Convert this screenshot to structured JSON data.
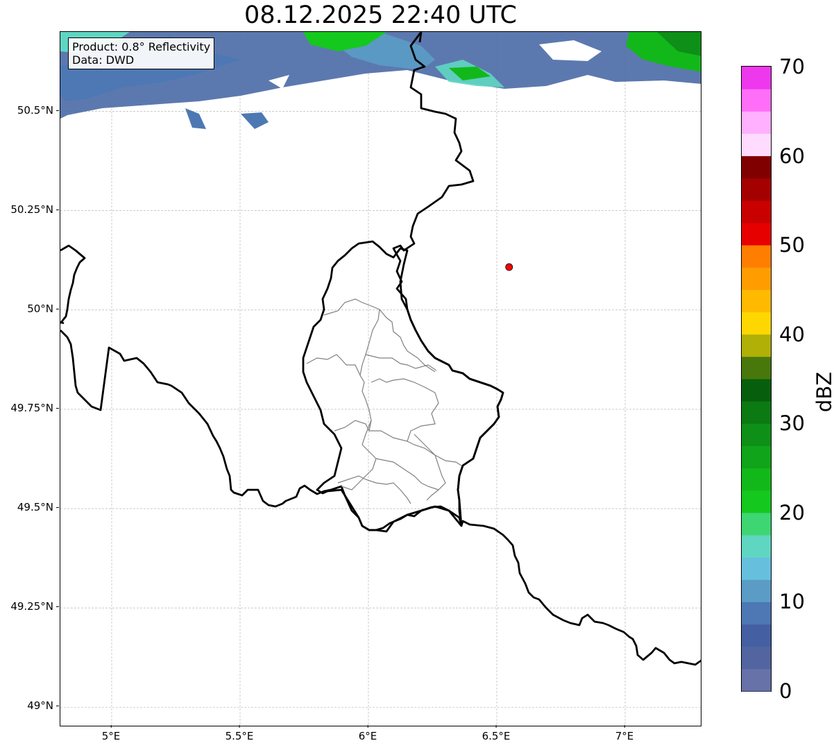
{
  "title": "08.12.2025 22:40 UTC",
  "info": {
    "product": "Product: 0.8° Reflectivity",
    "data": "Data: DWD"
  },
  "map": {
    "lon_range": [
      4.8,
      7.3
    ],
    "lat_range": [
      48.95,
      50.7
    ],
    "lat_ticks": [
      {
        "value": 49.0,
        "label": "49°N"
      },
      {
        "value": 49.25,
        "label": "49.25°N"
      },
      {
        "value": 49.5,
        "label": "49.5°N"
      },
      {
        "value": 49.75,
        "label": "49.75°N"
      },
      {
        "value": 50.0,
        "label": "50°N"
      },
      {
        "value": 50.25,
        "label": "50.25°N"
      },
      {
        "value": 50.5,
        "label": "50.5°N"
      }
    ],
    "lon_ticks": [
      {
        "value": 5.0,
        "label": "5°E"
      },
      {
        "value": 5.5,
        "label": "5.5°E"
      },
      {
        "value": 6.0,
        "label": "6°E"
      },
      {
        "value": 6.5,
        "label": "6.5°E"
      },
      {
        "value": 7.0,
        "label": "7°E"
      }
    ],
    "grid": true,
    "marker": {
      "lon": 6.548,
      "lat": 50.108,
      "color": "#ff0000"
    }
  },
  "colorbar": {
    "label": "dBZ",
    "range": [
      0,
      70
    ],
    "ticks": [
      "0",
      "10",
      "20",
      "30",
      "40",
      "50",
      "60",
      "70"
    ],
    "colors": [
      "#6672a8",
      "#5265a0",
      "#4460a2",
      "#4d78b3",
      "#5a9cc6",
      "#66c0dd",
      "#5fd6c2",
      "#3dd672",
      "#14c81e",
      "#12b81a",
      "#0fa41a",
      "#0e8f17",
      "#0b7a12",
      "#075f0e",
      "#48780b",
      "#b0b006",
      "#ffd700",
      "#ffba00",
      "#ff9c00",
      "#ff7e00",
      "#e60000",
      "#c80000",
      "#a40000",
      "#800000",
      "#ffdcff",
      "#ffb0ff",
      "#ff6ef8",
      "#ee38ee"
    ]
  }
}
